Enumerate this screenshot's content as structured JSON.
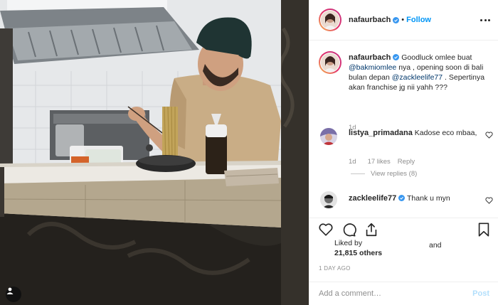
{
  "post": {
    "author": "nafaurbach",
    "follow_label": "Follow",
    "caption": {
      "author": "nafaurbach",
      "pre": "Goodluck omlee buat",
      "mention1": "@bakmiomlee",
      "mid": "nya , opening soon di bali bulan depan",
      "mention2": "@zackleelife77",
      "post": ". Sepertinya akan franchise jg nii yahh ???",
      "age": "1d"
    },
    "comments": [
      {
        "user": "listya_primadana",
        "text": "Kadose eco mbaa,",
        "age": "1d",
        "likes": "17 likes",
        "reply": "Reply",
        "view_replies": "View replies (8)"
      },
      {
        "user": "zackleelife77",
        "text": "Thank u myn"
      }
    ],
    "likes": {
      "line1": "Liked by",
      "and": "and",
      "line2": "21,815 others"
    },
    "timestamp": "1 DAY AGO",
    "add_comment": {
      "placeholder": "Add a comment…",
      "post_label": "Post"
    }
  },
  "colors": {
    "link": "#0095f6",
    "mention": "#00376b",
    "muted": "#8e8e8e",
    "verified": "#3897f0"
  },
  "icons": [
    "user-tag-icon",
    "more-options-icon",
    "heart-icon",
    "comment-icon",
    "share-icon",
    "bookmark-icon",
    "verified-badge-icon"
  ]
}
